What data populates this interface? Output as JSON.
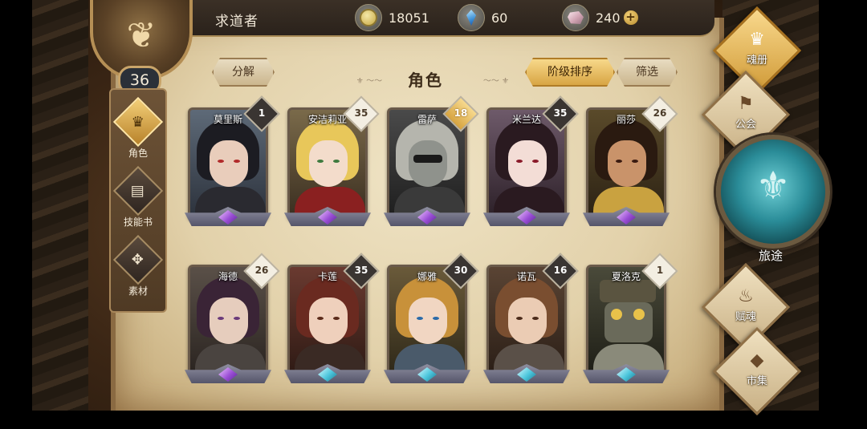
{
  "header": {
    "player_name": "求道者",
    "level": "36",
    "resources": [
      {
        "icon": "gold-coin-icon",
        "value": "18051"
      },
      {
        "icon": "blue-crystal-icon",
        "value": "60"
      },
      {
        "icon": "ore-stone-icon",
        "value": "240",
        "add_label": "+"
      }
    ]
  },
  "left_nav": [
    {
      "label": "角色",
      "icon": "character-crest-icon",
      "active": true
    },
    {
      "label": "技能书",
      "icon": "skill-book-icon",
      "active": false
    },
    {
      "label": "素材",
      "icon": "material-icon",
      "active": false
    }
  ],
  "panel": {
    "title": "角色",
    "decompose_label": "分解",
    "sort_label": "阶级排序",
    "filter_label": "筛选"
  },
  "characters": [
    {
      "name": "莫里斯",
      "level": "1",
      "tag_style": "dark",
      "gem": "purple"
    },
    {
      "name": "安洁莉亚",
      "level": "35",
      "tag_style": "light",
      "gem": "purple"
    },
    {
      "name": "雷萨",
      "level": "18",
      "tag_style": "gold",
      "gem": "purple"
    },
    {
      "name": "米兰达",
      "level": "35",
      "tag_style": "dark",
      "gem": "purple"
    },
    {
      "name": "丽莎",
      "level": "26",
      "tag_style": "light",
      "gem": "purple"
    },
    {
      "name": "海德",
      "level": "26",
      "tag_style": "light",
      "gem": "purple"
    },
    {
      "name": "卡莲",
      "level": "35",
      "tag_style": "dark",
      "gem": "cyan"
    },
    {
      "name": "娜雅",
      "level": "30",
      "tag_style": "dark",
      "gem": "cyan"
    },
    {
      "name": "诺瓦",
      "level": "16",
      "tag_style": "dark",
      "gem": "cyan"
    },
    {
      "name": "夏洛克",
      "level": "1",
      "tag_style": "light",
      "gem": "cyan"
    }
  ],
  "right_menu": [
    {
      "label": "魂册",
      "icon": "soul-book-icon"
    },
    {
      "label": "公会",
      "icon": "guild-icon"
    },
    {
      "label": "旅途",
      "icon": "journey-icon"
    },
    {
      "label": "赋魂",
      "icon": "soul-flame-icon"
    },
    {
      "label": "市集",
      "icon": "market-gem-icon"
    }
  ]
}
